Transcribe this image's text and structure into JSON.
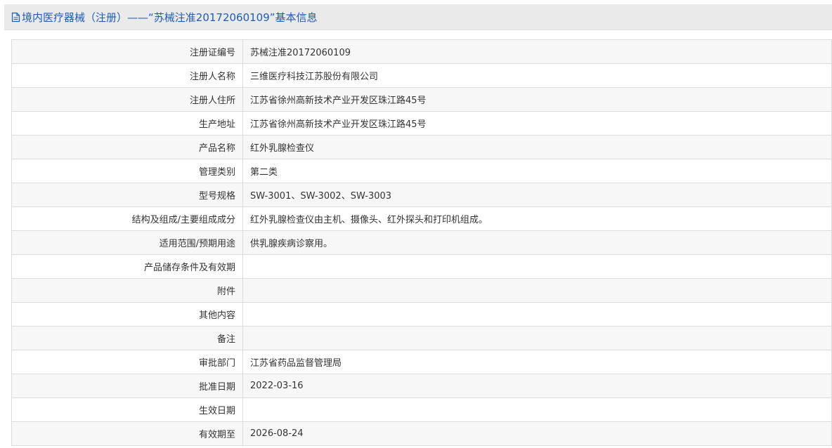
{
  "header": {
    "title": "境内医疗器械（注册）——“苏械注准20172060109”基本信息",
    "icon": "document-icon",
    "accent_color": "#1e5cb3"
  },
  "rows": [
    {
      "label": "注册证编号",
      "value": "苏械注准20172060109"
    },
    {
      "label": "注册人名称",
      "value": "三维医疗科技江苏股份有限公司"
    },
    {
      "label": "注册人住所",
      "value": "江苏省徐州高新技术产业开发区珠江路45号"
    },
    {
      "label": "生产地址",
      "value": "江苏省徐州高新技术产业开发区珠江路45号"
    },
    {
      "label": "产品名称",
      "value": "红外乳腺检查仪"
    },
    {
      "label": "管理类别",
      "value": "第二类"
    },
    {
      "label": "型号规格",
      "value": "SW-3001、SW-3002、SW-3003"
    },
    {
      "label": "结构及组成/主要组成成分",
      "value": "红外乳腺检查仪由主机、摄像头、红外探头和打印机组成。"
    },
    {
      "label": "适用范围/预期用途",
      "value": "供乳腺疾病诊察用。"
    },
    {
      "label": "产品储存条件及有效期",
      "value": ""
    },
    {
      "label": "附件",
      "value": ""
    },
    {
      "label": "其他内容",
      "value": ""
    },
    {
      "label": "备注",
      "value": ""
    },
    {
      "label": "审批部门",
      "value": "江苏省药品监督管理局"
    },
    {
      "label": "批准日期",
      "value": "2022-03-16"
    },
    {
      "label": "生效日期",
      "value": ""
    },
    {
      "label": "有效期至",
      "value": "2026-08-24"
    }
  ]
}
